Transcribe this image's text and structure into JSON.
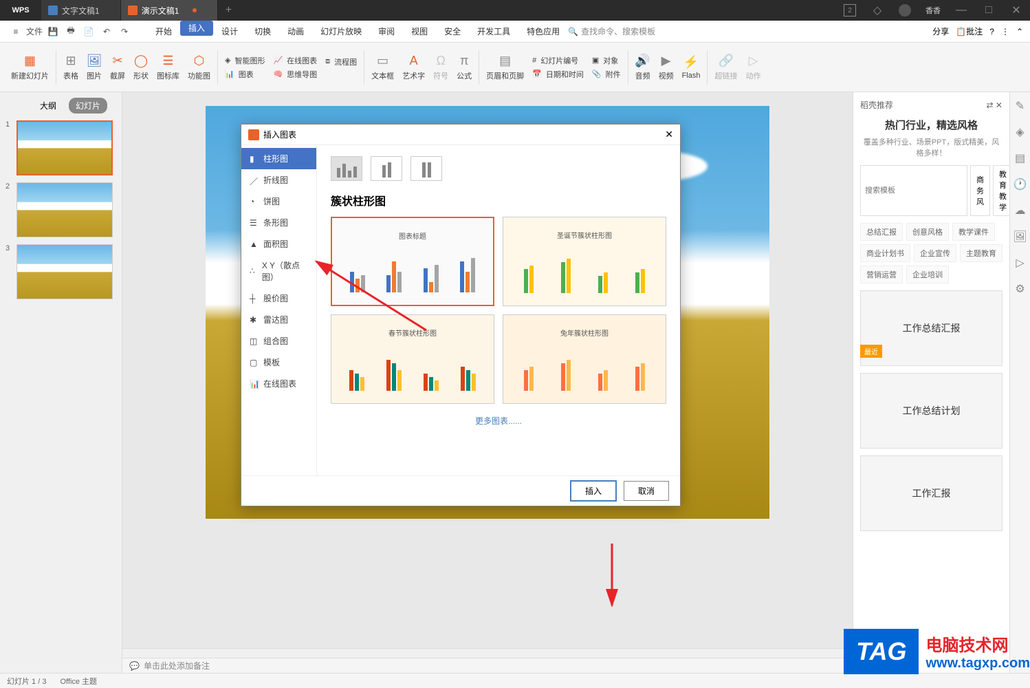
{
  "titlebar": {
    "logo": "WPS",
    "tabs": [
      {
        "label": "文字文稿1",
        "type": "word"
      },
      {
        "label": "演示文稿1",
        "type": "ppt",
        "active": true,
        "modified": true
      }
    ],
    "badge": "2",
    "username": "香香"
  },
  "menubar": {
    "file": "文件",
    "tabs": [
      "开始",
      "插入",
      "设计",
      "切换",
      "动画",
      "幻灯片放映",
      "审阅",
      "视图",
      "安全",
      "开发工具",
      "特色应用"
    ],
    "active_tab": "插入",
    "search": "查找命令、搜索模板",
    "share": "分享",
    "comment": "批注"
  },
  "ribbon": {
    "new_slide": "新建幻灯片",
    "table": "表格",
    "picture": "图片",
    "screenshot": "截屏",
    "shape": "形状",
    "icon_lib": "图标库",
    "function": "功能图",
    "smart": "智能图形",
    "online_chart": "在线图表",
    "flow": "流程图",
    "mind": "思维导图",
    "chart": "图表",
    "textbox": "文本框",
    "wordart": "艺术字",
    "symbol": "符号",
    "formula": "公式",
    "header": "页眉和页脚",
    "slidenum": "幻灯片编号",
    "datetime": "日期和时间",
    "object": "对象",
    "attachment": "附件",
    "audio": "音频",
    "video": "视频",
    "flash": "Flash",
    "hyperlink": "超链接",
    "action": "动作"
  },
  "slide_panel": {
    "outline": "大纲",
    "slides": "幻灯片"
  },
  "dialog": {
    "title": "插入图表",
    "types": [
      "柱形图",
      "折线图",
      "饼图",
      "条形图",
      "面积图",
      "X Y（散点图）",
      "股价图",
      "雷达图",
      "组合图",
      "模板",
      "在线图表"
    ],
    "active_type": "柱形图",
    "selected_name": "簇状柱形图",
    "previews": [
      "图表标题",
      "圣诞节簇状柱形图",
      "春节簇状柱形图",
      "兔年簇状柱形图"
    ],
    "more": "更多图表......",
    "insert": "插入",
    "cancel": "取消"
  },
  "right_panel": {
    "header": "稻壳推荐",
    "title": "热门行业，精选风格",
    "subtitle": "覆盖多种行业、场景PPT，版式精美，风格多样！",
    "search_placeholder": "搜索模板",
    "quick_btns": [
      "商务风",
      "教育教学"
    ],
    "tags": [
      "总结汇报",
      "创意风格",
      "教学课件",
      "商业计划书",
      "企业宣传",
      "主题教育",
      "营销运营",
      "企业培训"
    ],
    "recent": "最近",
    "templates": [
      "工作总结汇报",
      "工作总结计划",
      "工作汇报"
    ]
  },
  "notes": "单击此处添加备注",
  "statusbar": {
    "slide_info": "幻灯片 1 / 3",
    "theme": "Office 主题"
  },
  "watermark": {
    "tag": "TAG",
    "line1": "电脑技术网",
    "line2": "www.tagxp.com"
  }
}
